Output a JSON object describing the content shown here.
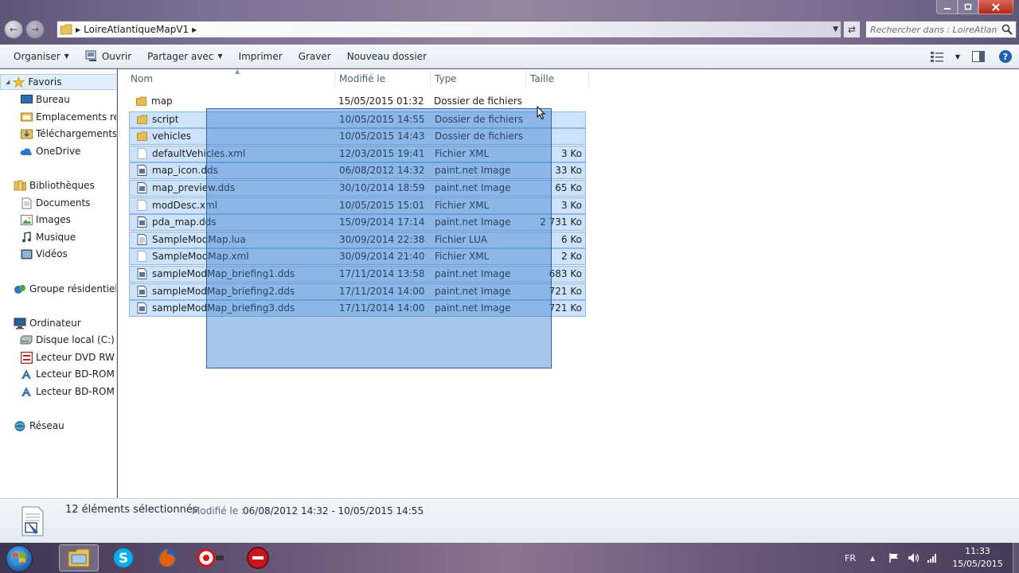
{
  "address": {
    "crumb": "LoireAtlantiqueMapV1"
  },
  "search": {
    "placeholder": "Rechercher dans : LoireAtlanti..."
  },
  "toolbar": {
    "organize": "Organiser",
    "open": "Ouvrir",
    "share": "Partager avec",
    "print": "Imprimer",
    "burn": "Graver",
    "new_folder": "Nouveau dossier"
  },
  "nav": {
    "favorites": "Favoris",
    "desktop": "Bureau",
    "recent": "Emplacements réc",
    "downloads": "Téléchargements",
    "onedrive": "OneDrive",
    "libraries": "Bibliothèques",
    "documents": "Documents",
    "images": "Images",
    "music": "Musique",
    "videos": "Vidéos",
    "homegroup": "Groupe résidentiel",
    "computer": "Ordinateur",
    "disk_c": "Disque local (C:)",
    "dvd": "Lecteur DVD RW (I",
    "bd1": "Lecteur BD-ROM (I",
    "bd2": "Lecteur BD-ROM (I",
    "network": "Réseau"
  },
  "columns": {
    "name": "Nom",
    "modified": "Modifié le",
    "type": "Type",
    "size": "Taille"
  },
  "files": [
    {
      "name": "map",
      "date": "15/05/2015 01:32",
      "type": "Dossier de fichiers",
      "size": "",
      "kind": "folder",
      "selected": false
    },
    {
      "name": "script",
      "date": "10/05/2015 14:55",
      "type": "Dossier de fichiers",
      "size": "",
      "kind": "folder",
      "selected": true
    },
    {
      "name": "vehicles",
      "date": "10/05/2015 14:43",
      "type": "Dossier de fichiers",
      "size": "",
      "kind": "folder",
      "selected": true
    },
    {
      "name": "defaultVehicles.xml",
      "date": "12/03/2015 19:41",
      "type": "Fichier XML",
      "size": "3 Ko",
      "kind": "xml",
      "selected": true
    },
    {
      "name": "map_icon.dds",
      "date": "06/08/2012 14:32",
      "type": "paint.net Image",
      "size": "33 Ko",
      "kind": "image",
      "selected": true
    },
    {
      "name": "map_preview.dds",
      "date": "30/10/2014 18:59",
      "type": "paint.net Image",
      "size": "65 Ko",
      "kind": "image",
      "selected": true
    },
    {
      "name": "modDesc.xml",
      "date": "10/05/2015 15:01",
      "type": "Fichier XML",
      "size": "3 Ko",
      "kind": "xml",
      "selected": true
    },
    {
      "name": "pda_map.dds",
      "date": "15/09/2014 17:14",
      "type": "paint.net Image",
      "size": "2 731 Ko",
      "kind": "image",
      "selected": true
    },
    {
      "name": "SampleModMap.lua",
      "date": "30/09/2014 22:38",
      "type": "Fichier LUA",
      "size": "6 Ko",
      "kind": "lua",
      "selected": true
    },
    {
      "name": "SampleModMap.xml",
      "date": "30/09/2014 21:40",
      "type": "Fichier XML",
      "size": "2 Ko",
      "kind": "xml",
      "selected": true
    },
    {
      "name": "sampleModMap_briefing1.dds",
      "date": "17/11/2014 13:58",
      "type": "paint.net Image",
      "size": "683 Ko",
      "kind": "image",
      "selected": true
    },
    {
      "name": "sampleModMap_briefing2.dds",
      "date": "17/11/2014 14:00",
      "type": "paint.net Image",
      "size": "721 Ko",
      "kind": "image",
      "selected": true
    },
    {
      "name": "sampleModMap_briefing3.dds",
      "date": "17/11/2014 14:00",
      "type": "paint.net Image",
      "size": "721 Ko",
      "kind": "image",
      "selected": true
    }
  ],
  "details": {
    "count": "12 éléments sélectionnés",
    "modified_label": "Modifié le :",
    "modified_value": "06/08/2012 14:32 - 10/05/2015 14:55"
  },
  "tray": {
    "lang": "FR",
    "time": "11:33",
    "date": "15/05/2015"
  }
}
